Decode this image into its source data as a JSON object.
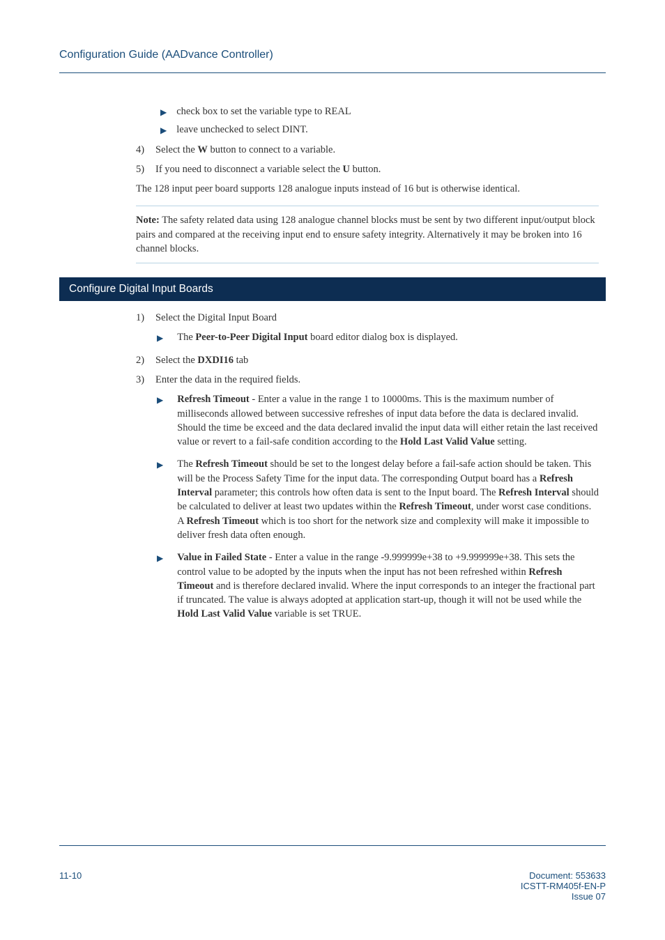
{
  "header": {
    "title": "Configuration Guide (AADvance Controller)"
  },
  "body": {
    "sub1": "check box to set the variable type to REAL",
    "sub2": "leave unchecked to select DINT.",
    "num4_lbl": "4)",
    "num4_a": "Select the ",
    "num4_b": "W",
    "num4_c": " button to connect to a variable.",
    "num5_lbl": "5)",
    "num5_a": "If you need to disconnect a variable select the ",
    "num5_b": "U",
    "num5_c": " button.",
    "para1": "The 128 input peer board supports 128 analogue inputs instead of 16 but is otherwise identical.",
    "note_a": "Note:",
    "note_b": " The safety related data using 128 analogue channel blocks must be sent by two different input/output block pairs and compared at the receiving input end to ensure safety integrity. Alternatively it may be broken into 16 channel blocks."
  },
  "section": {
    "title": "Configure Digital Input Boards",
    "n1_lbl": "1)",
    "n1_txt": "Select the Digital Input Board",
    "n1_sub_a": "The ",
    "n1_sub_b": "Peer-to-Peer Digital Input",
    "n1_sub_c": " board editor dialog box is displayed.",
    "n2_lbl": "2)",
    "n2_a": "Select the ",
    "n2_b": "DXDI16",
    "n2_c": " tab",
    "n3_lbl": "3)",
    "n3_txt": "Enter the data in the required fields.",
    "b1_a": "Refresh Timeout",
    "b1_b": " - Enter a value in the range 1 to 10000ms. This is the maximum number of milliseconds allowed between successive refreshes of input data before the data is declared invalid. Should the time be exceed and the data declared invalid the input data will either retain the last received value or revert to a fail-safe condition according to the ",
    "b1_c": "Hold Last Valid Value",
    "b1_d": " setting.",
    "b2_a": "The ",
    "b2_b": "Refresh Timeout",
    "b2_c": " should be set to the longest delay before a fail-safe action should be taken. This will be the Process Safety Time for the input data. The corresponding Output board has a ",
    "b2_d": "Refresh Interval",
    "b2_e": " parameter; this controls how often data is sent to the Input board. The ",
    "b2_f": "Refresh Interval",
    "b2_g": " should be calculated to deliver at least two updates within the ",
    "b2_h": "Refresh Timeout",
    "b2_i": ", under worst case conditions. A ",
    "b2_j": "Refresh Timeout",
    "b2_k": " which is too short for the network size and complexity will make it impossible to deliver fresh data often enough.",
    "b3_a": "Value in Failed State",
    "b3_b": " - Enter a value in the range -9.999999e+38 to +9.999999e+38. This sets the control value to be adopted by the inputs when the input has not been refreshed within ",
    "b3_c": "Refresh Timeout",
    "b3_d": " and is therefore declared invalid. Where the input corresponds to an integer the fractional part if truncated. The value is always adopted at application start-up, though it will not be used while the ",
    "b3_e": "Hold Last Valid Value",
    "b3_f": " variable is set TRUE."
  },
  "footer": {
    "page": "11-10",
    "doc": "Document: 553633",
    "ref": "ICSTT-RM405f-EN-P",
    "issue": "Issue 07"
  }
}
